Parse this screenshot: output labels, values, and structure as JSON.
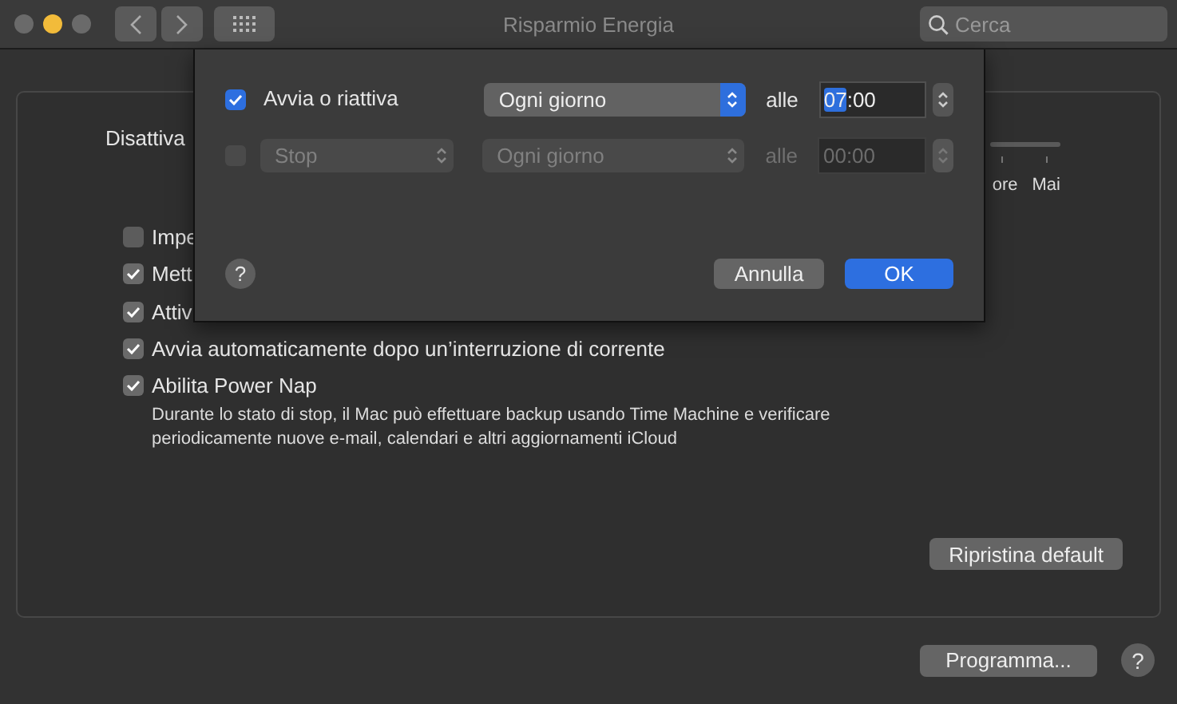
{
  "window": {
    "title": "Risparmio Energia"
  },
  "search": {
    "placeholder": "Cerca"
  },
  "settings": {
    "turn_off_label": "Disattiva",
    "slider_labels": [
      "ore",
      "Mai"
    ],
    "options": [
      {
        "label": "Impe",
        "checked": false
      },
      {
        "label": "Mett",
        "checked": true
      },
      {
        "label": "Attiv",
        "checked": true
      },
      {
        "label": "Avvia automaticamente dopo un’interruzione di corrente",
        "checked": true
      },
      {
        "label": "Abilita Power Nap",
        "checked": true
      }
    ],
    "power_nap_description": "Durante lo stato di stop, il Mac può effettuare backup usando Time Machine e verificare periodicamente nuove e-mail, calendari e altri aggiornamenti iCloud",
    "restore_button": "Ripristina default"
  },
  "schedule_button": "Programma...",
  "help_label": "?",
  "sheet": {
    "rows": [
      {
        "kind": "label",
        "event": "Avvia o riattiva",
        "checked": true,
        "disabled": false,
        "repeat": "Ogni giorno",
        "at_label": "alle",
        "time_hours": "07",
        "time_rest": ":00",
        "hours_selected": true
      },
      {
        "kind": "popup",
        "event": "Stop",
        "checked": false,
        "disabled": true,
        "repeat": "Ogni giorno",
        "at_label": "alle",
        "time_hours": "00",
        "time_rest": ":00",
        "hours_selected": false
      }
    ],
    "help_label": "?",
    "cancel_button": "Annulla",
    "ok_button": "OK"
  }
}
